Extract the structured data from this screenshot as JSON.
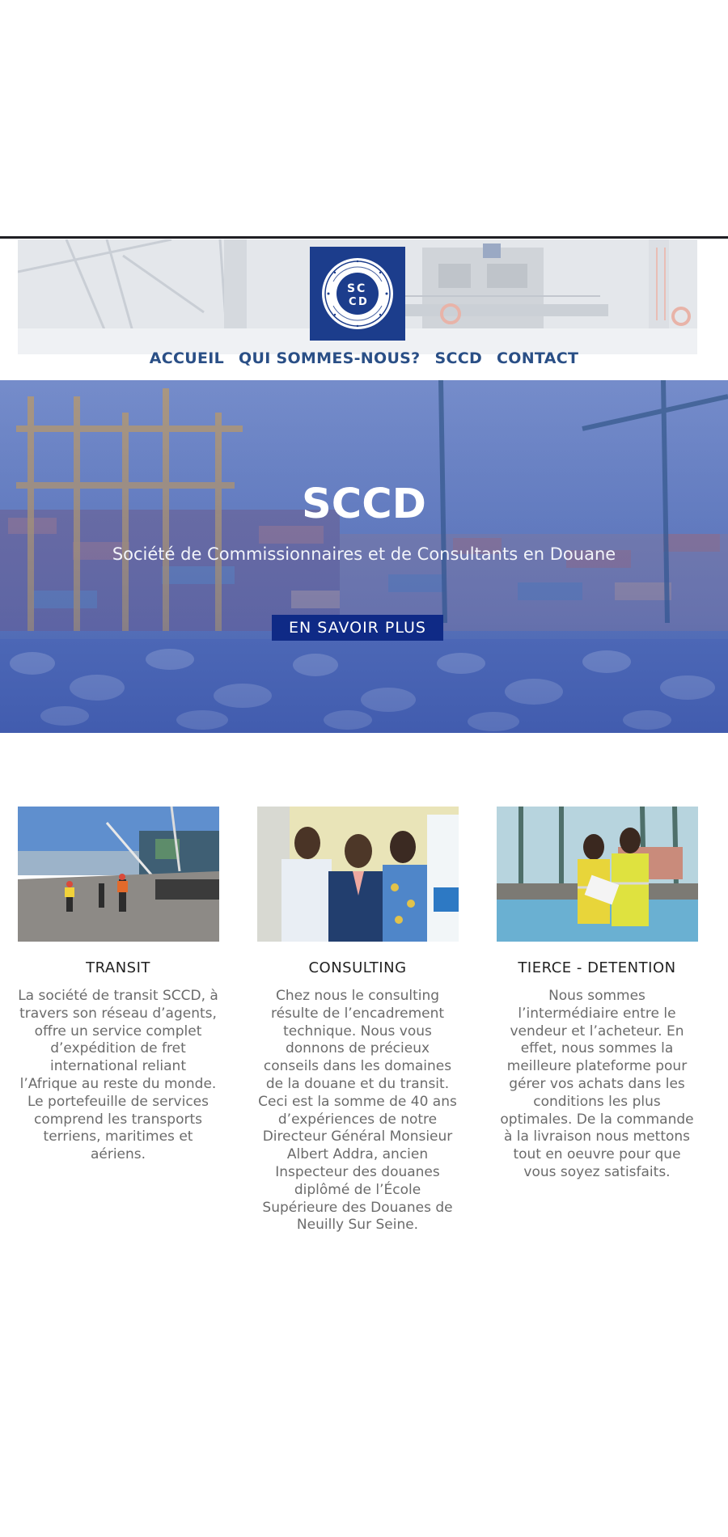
{
  "brand": {
    "logo_icon": "sccd-seal-icon",
    "logo_text": "SOCIETE DE COMMISSIONNAIRES ET DE CONSULTANTS EN DOUANE · SCCD",
    "colors": {
      "navy": "#1c3d8c",
      "nav_text": "#2a4f86",
      "button": "#0f2a86"
    }
  },
  "nav": {
    "items": [
      {
        "label": "ACCUEIL"
      },
      {
        "label": "QUI SOMMES-NOUS?"
      },
      {
        "label": "SCCD"
      },
      {
        "label": "CONTACT"
      }
    ]
  },
  "hero": {
    "title": "SCCD",
    "subtitle": "Société de Commissionnaires et de Consultants en Douane",
    "button_label": "EN SAVOIR PLUS"
  },
  "services": [
    {
      "title": "TRANSIT",
      "lines": [
        "La société de transit SCCD, à",
        "travers son réseau d’agents,",
        "offre un service complet",
        "d’expédition de fret",
        "international reliant",
        "l’Afrique au reste du monde.",
        "Le portefeuille de services",
        "comprend les transports",
        "terriens, maritimes et",
        "aériens."
      ]
    },
    {
      "title": "CONSULTING",
      "lines": [
        "Chez nous le consulting",
        "résulte de l’encadrement",
        "technique. Nous vous",
        "donnons de précieux",
        "conseils dans les domaines",
        "de la douane et du transit.",
        "Ceci est la somme de 40 ans",
        "d’expériences de notre",
        "Directeur Général Monsieur",
        "Albert Addra, ancien",
        "Inspecteur des douanes",
        "diplômé de l’École",
        "Supérieure des Douanes de",
        "Neuilly Sur Seine."
      ]
    },
    {
      "title": "TIERCE - DETENTION",
      "lines": [
        "Nous sommes",
        "l’intermédiaire entre le",
        "vendeur et l’acheteur. En",
        "effet, nous sommes la",
        "meilleure plateforme pour",
        "gérer vos achats dans les",
        "conditions les plus",
        "optimales. De la commande",
        "à la livraison nous mettons",
        "tout en oeuvre pour que",
        "vous soyez satisfaits."
      ]
    }
  ]
}
